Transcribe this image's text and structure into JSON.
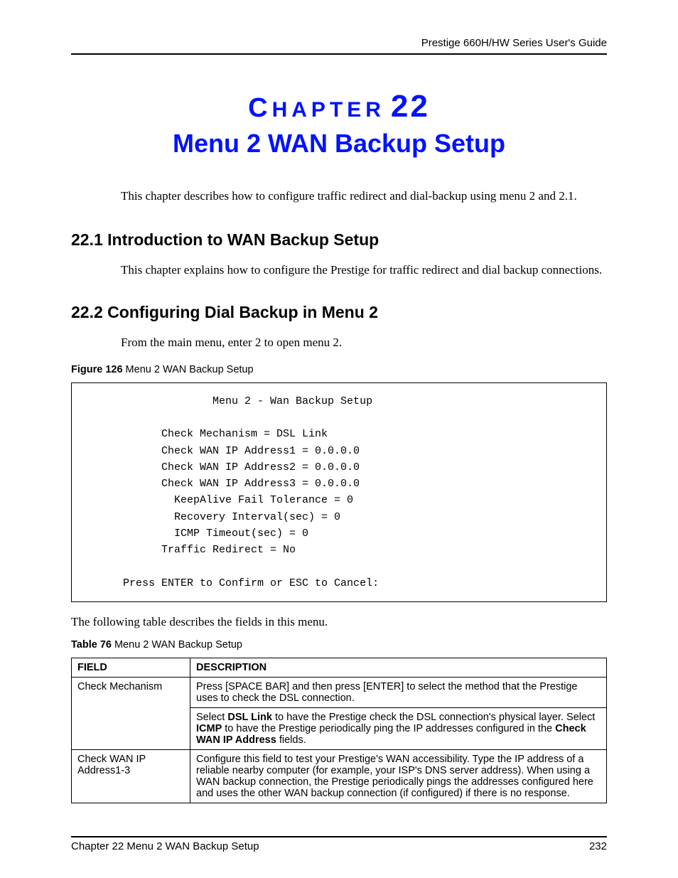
{
  "header": {
    "guide_title": "Prestige 660H/HW Series User's Guide"
  },
  "chapter": {
    "label_small": "C",
    "label_rest": "HAPTER",
    "number": "22",
    "title": "Menu 2 WAN Backup Setup",
    "intro": "This chapter describes how to configure traffic redirect and dial-backup using menu 2 and 2.1."
  },
  "section1": {
    "heading": "22.1  Introduction to WAN Backup Setup",
    "para": "This chapter explains how to configure the Prestige for traffic redirect and dial backup connections."
  },
  "section2": {
    "heading": "22.2  Configuring Dial Backup in Menu 2",
    "para": "From the main menu, enter 2 to open menu 2.",
    "figure_label_bold": "Figure 126",
    "figure_label_rest": "   Menu 2 WAN Backup Setup",
    "figure_text": "                    Menu 2 - Wan Backup Setup\n\n            Check Mechanism = DSL Link\n            Check WAN IP Address1 = 0.0.0.0\n            Check WAN IP Address2 = 0.0.0.0\n            Check WAN IP Address3 = 0.0.0.0\n              KeepAlive Fail Tolerance = 0\n              Recovery Interval(sec) = 0\n              ICMP Timeout(sec) = 0\n            Traffic Redirect = No\n\n      Press ENTER to Confirm or ESC to Cancel:",
    "after_figure": "The following table describes the fields in this menu.",
    "table_label_bold": "Table 76",
    "table_label_rest": "   Menu 2 WAN Backup Setup"
  },
  "table": {
    "head_field": "FIELD",
    "head_desc": "DESCRIPTION",
    "rows": [
      {
        "field": "Check Mechanism",
        "desc1": "Press [SPACE BAR] and then press [ENTER] to select the method that the Prestige uses to check the DSL connection.",
        "desc2_pre": "Select ",
        "desc2_b1": "DSL Link",
        "desc2_mid1": " to have the Prestige check the DSL connection's physical layer. Select ",
        "desc2_b2": "ICMP",
        "desc2_mid2": " to have the Prestige periodically ping the IP addresses configured in the ",
        "desc2_b3": "Check WAN IP Address",
        "desc2_post": " fields."
      },
      {
        "field": "Check WAN IP Address1-3",
        "desc": "Configure this field to test your Prestige's WAN accessibility. Type the IP address of a reliable nearby computer (for example, your ISP's DNS server address). When using a WAN backup connection, the Prestige periodically pings the addresses configured here and uses the other WAN backup connection (if configured) if there is no response."
      }
    ]
  },
  "footer": {
    "left": "Chapter 22 Menu 2 WAN Backup Setup",
    "right": "232"
  }
}
